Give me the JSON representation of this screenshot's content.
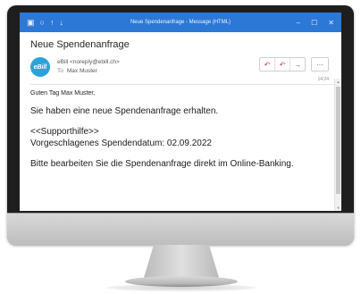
{
  "window": {
    "title": "Neue Spendenanfrage - Message (HTML)"
  },
  "message": {
    "subject": "Neue Spendenanfrage",
    "avatar_text": "eBill",
    "from": "eBill <noreply@ebill.ch>",
    "to_label": "To",
    "to": "Max Muster",
    "time": "14:24",
    "greeting": "Guten Tag Max Muster,",
    "line1": "Sie haben eine neue Spendenanfrage erhalten.",
    "line2": "<<Supporthilfe>>",
    "line3": "Vorgeschlagenes Spendendatum: 02.09.2022",
    "line4": "Bitte bearbeiten Sie die Spendenanfrage direkt im Online-Banking."
  },
  "icons": {
    "app": "outlook-icon",
    "save": "save-icon",
    "up": "arrow-up-icon",
    "down": "arrow-down-icon",
    "reply": "reply-icon",
    "reply_all": "reply-all-icon",
    "forward": "forward-icon",
    "more": "more-icon",
    "minimize": "minimize-icon",
    "maximize": "maximize-icon",
    "close": "close-icon"
  },
  "colors": {
    "titlebar": "#2b78d6",
    "avatar": "#2aa3d8",
    "reply": "#c2418b",
    "forward": "#3b6fc9"
  }
}
